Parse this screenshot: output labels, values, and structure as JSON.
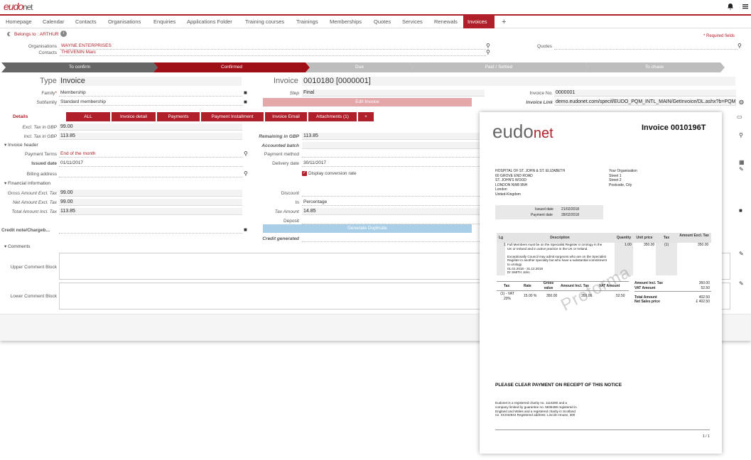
{
  "header": {
    "logo_a": "eudo",
    "logo_b": "net"
  },
  "nav": {
    "tabs": [
      "Homepage",
      "Calendar",
      "Contacts",
      "Organisations",
      "Enquiries",
      "Applications Folder",
      "Training courses",
      "Trainings",
      "Memberships",
      "Quotes",
      "Services",
      "Renewals",
      "Invoices",
      "+"
    ]
  },
  "belongs": "Belongs to : ARTHUR",
  "required": "* Required fields",
  "org": {
    "label": "Organisations",
    "value": "WAYNE ENTERPRISES"
  },
  "contacts": {
    "label": "Contacts",
    "value": "THEVENIN Marc"
  },
  "quotes": {
    "label": "Quotes"
  },
  "steps": [
    "To confirm",
    "Confirmed",
    "Due",
    "Paid / Settled",
    "To chase"
  ],
  "type": {
    "label": "Type",
    "value": "Invoice"
  },
  "invoice": {
    "label": "Invoice",
    "value": "0010180 [0000001]"
  },
  "family": {
    "label": "Family",
    "value": "Membership"
  },
  "subfamily": {
    "label": "Subfamily",
    "value": "Standard membership"
  },
  "step": {
    "label": "Step",
    "value": "Final"
  },
  "edit_invoice": "Edit Invoice",
  "invoice_no": {
    "label": "Invoice No.",
    "value": "0000001"
  },
  "invoice_link": {
    "label": "Invoice Link",
    "value": "demo.eudonet.com/specif/EUDO_PQM_INTL_MAIN/GetInvoice/DL.ashx?b=PQM_I..."
  },
  "details": "Details",
  "detail_tabs": [
    "ALL",
    "Invoice detail",
    "Payments",
    "Payment Installment",
    "Invoice Email",
    "Attachments (1)",
    "+"
  ],
  "excl": {
    "label": "Excl. Tax in GBP",
    "value": "99.00"
  },
  "incl": {
    "label": "Incl. Tax in GBP",
    "value": "113.85"
  },
  "remaining": {
    "label": "Remaining in GBP",
    "value": "113.85"
  },
  "accounted": {
    "label": "Accounted batch"
  },
  "inv_header": "Invoice header",
  "pay_terms": {
    "label": "Payment Terms",
    "value": "End of the month"
  },
  "pay_method": {
    "label": "Payment method"
  },
  "issued": {
    "label": "Issued date",
    "value": "01/11/2017"
  },
  "delivery": {
    "label": "Delivery date",
    "value": "30/11/2017"
  },
  "billing": {
    "label": "Billing address"
  },
  "display_rate": "Display conversion rate",
  "fin_info": "Financial information",
  "gross": {
    "label": "Gross Amount Excl. Tax",
    "value": "99.00"
  },
  "net": {
    "label": "Net Amount Excl. Tax",
    "value": "99.00"
  },
  "total": {
    "label": "Total Amount Incl. Tax",
    "value": "113.85"
  },
  "discount": {
    "label": "Discount"
  },
  "in_": {
    "label": "In",
    "value": "Percentage"
  },
  "tax_amount": {
    "label": "Tax Amount",
    "value": "14.85"
  },
  "deposit": {
    "label": "Deposit"
  },
  "credit_note": {
    "label": "Credit note/Chargeb..."
  },
  "gen_dup": "Generate Duplicate",
  "credit_gen": {
    "label": "Credit generated"
  },
  "comments": "Comments",
  "upper": "Upper Comment Block",
  "lower": "Lower Comment Block",
  "doc": {
    "title": "Invoice 0010196T",
    "logo_a": "eudo",
    "logo_b": "net",
    "to": "HOSPITAL OF ST. JOHN & ST. ELIZABETH\n60 GROVE END ROAD\nST. JOHN'S WOOD\nLONDON NW8 9NH\nLondon\nUnited-Kingdom",
    "from": "Your Organisation\nStreet 1\nStreet 2\nPostcode, City",
    "issued_lbl": "Issued date",
    "issued": "21/02/2018",
    "payment_lbl": "Payment date",
    "payment": "28/02/2018",
    "cols": [
      "Lg",
      "Description",
      "Quantity",
      "Unit price",
      "Tax",
      "Amount Excl. Tax"
    ],
    "row_lg": "1",
    "row_desc": "Full Members must be on the Specialist Register in Urology in the\nUK or Ireland and in active practice in the UK or Ireland.\n\nExceptionally Council may admit surgeons who are on the Specialist\nRegister in another specialty but who have a substantial commitment\nto urology.\n01.01.2018 - 31.12.2018\nDr SMITH John",
    "row_qty": "1.00",
    "row_unit": "350.00",
    "row_tax": "(1)",
    "row_amt": "350.00",
    "tcols": [
      "Tax",
      "Rate",
      "Gross value",
      "Amount Incl. Tax",
      "VAT Amount"
    ],
    "trow": [
      "(1) - VAT 20%",
      "15.00 %",
      "350.00",
      "350.00",
      "52.50"
    ],
    "sum_lbls": "Amount Incl. Tax\nVAT Amount\n\nTotal Amount\nNet Sales price",
    "sum_vals": "350.00\n52.50\n\n402.50\n£ 402.50",
    "watermark": "Proforma",
    "notice": "PLEASE CLEAR PAYMENT ON RECEIPT OF THIS NOTICE",
    "footer": "Eudonet is a registered charity no. 1116280 and a\ncompany limited by guarantee no. 5836486 registered in\nEngland and Wales and a registered charity in Scotland\nno. SC042944 Registered address: Lincoln House, 300",
    "page": "1 / 1"
  }
}
